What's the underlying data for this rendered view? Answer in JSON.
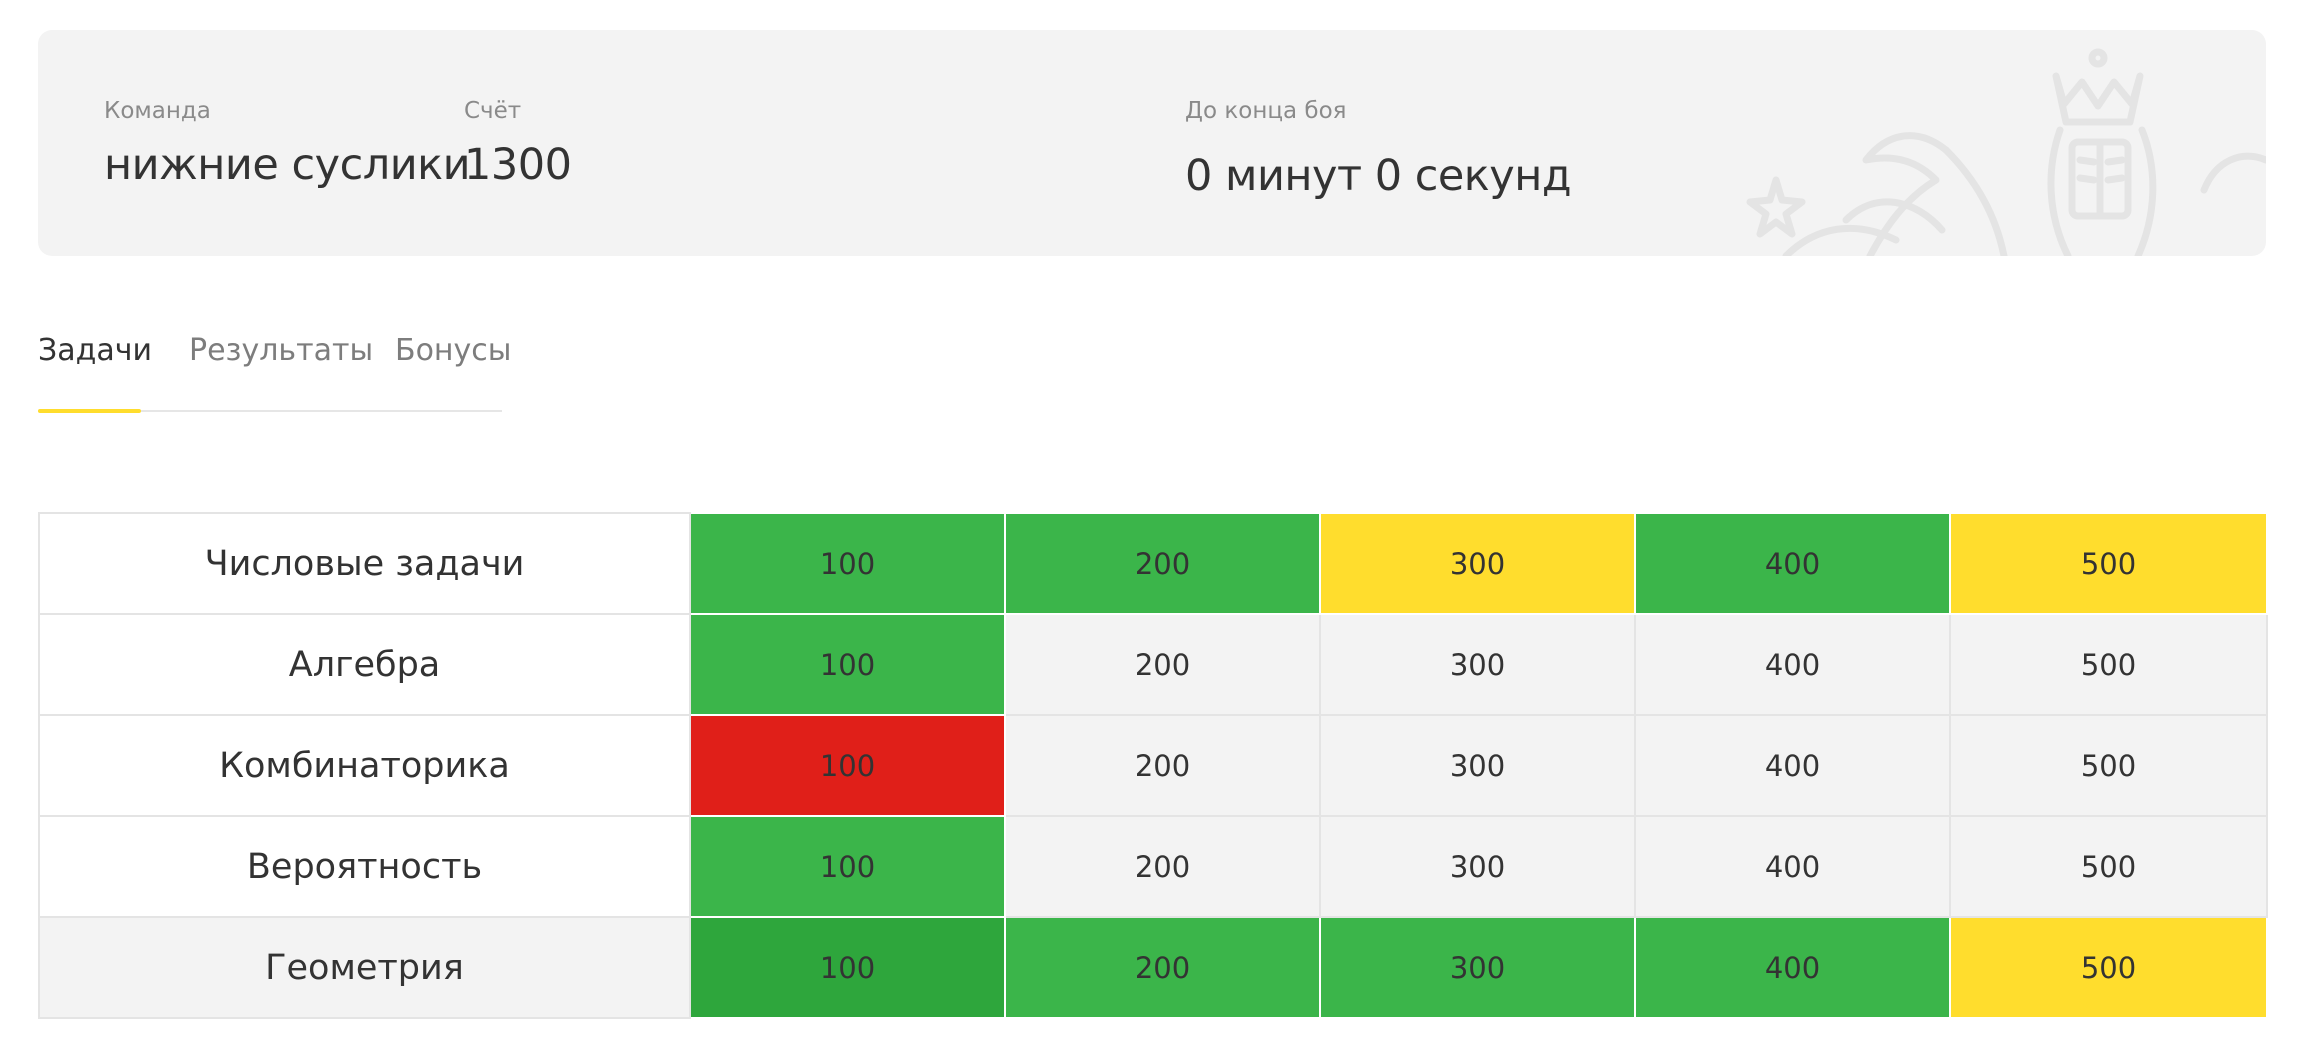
{
  "header": {
    "team_label": "Команда",
    "team_name": "нижние суслики",
    "score_label": "Счёт",
    "score": "1300",
    "timer_label": "До конца боя",
    "timer": "0 минут 0 секунд",
    "emblem_icon": "bank-emblem-icon"
  },
  "tabs": [
    {
      "label": "Задачи",
      "active": true
    },
    {
      "label": "Результаты",
      "active": false
    },
    {
      "label": "Бонусы",
      "active": false
    }
  ],
  "colors": {
    "accent": "#ffdd2d",
    "solved": "#3bb54a",
    "solved_dark": "#2ea63c",
    "pending": "#ffdd2d",
    "failed": "#e01f19",
    "unsolved": "#f3f3f3"
  },
  "grid": {
    "rows": [
      {
        "topic": "Числовые задачи",
        "cells": [
          {
            "value": "100",
            "status": "solved"
          },
          {
            "value": "200",
            "status": "solved"
          },
          {
            "value": "300",
            "status": "pending"
          },
          {
            "value": "400",
            "status": "solved"
          },
          {
            "value": "500",
            "status": "pending"
          }
        ]
      },
      {
        "topic": "Алгебра",
        "cells": [
          {
            "value": "100",
            "status": "solved"
          },
          {
            "value": "200",
            "status": "unsolved"
          },
          {
            "value": "300",
            "status": "unsolved"
          },
          {
            "value": "400",
            "status": "unsolved"
          },
          {
            "value": "500",
            "status": "unsolved"
          }
        ]
      },
      {
        "topic": "Комбинаторика",
        "cells": [
          {
            "value": "100",
            "status": "failed"
          },
          {
            "value": "200",
            "status": "unsolved"
          },
          {
            "value": "300",
            "status": "unsolved"
          },
          {
            "value": "400",
            "status": "unsolved"
          },
          {
            "value": "500",
            "status": "unsolved"
          }
        ]
      },
      {
        "topic": "Вероятность",
        "cells": [
          {
            "value": "100",
            "status": "solved"
          },
          {
            "value": "200",
            "status": "unsolved"
          },
          {
            "value": "300",
            "status": "unsolved"
          },
          {
            "value": "400",
            "status": "unsolved"
          },
          {
            "value": "500",
            "status": "unsolved"
          }
        ]
      },
      {
        "topic": "Геометрия",
        "cells": [
          {
            "value": "100",
            "status": "solved_dark"
          },
          {
            "value": "200",
            "status": "solved"
          },
          {
            "value": "300",
            "status": "solved"
          },
          {
            "value": "400",
            "status": "solved"
          },
          {
            "value": "500",
            "status": "pending"
          }
        ]
      }
    ]
  }
}
